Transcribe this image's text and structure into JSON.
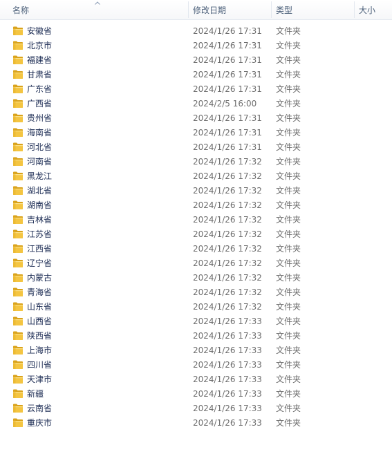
{
  "columns": {
    "name": "名称",
    "date_modified": "修改日期",
    "type": "类型",
    "size": "大小"
  },
  "colors": {
    "folder_yellow": "#f4c542",
    "folder_dark": "#d9a21b",
    "header_text": "#4c607a",
    "secondary_text": "#6d6d6d"
  },
  "items": [
    {
      "name": "安徽省",
      "date": "2024/1/26 17:31",
      "type": "文件夹",
      "icon": "folder-icon"
    },
    {
      "name": "北京市",
      "date": "2024/1/26 17:31",
      "type": "文件夹",
      "icon": "folder-icon"
    },
    {
      "name": "福建省",
      "date": "2024/1/26 17:31",
      "type": "文件夹",
      "icon": "folder-icon"
    },
    {
      "name": "甘肃省",
      "date": "2024/1/26 17:31",
      "type": "文件夹",
      "icon": "folder-icon"
    },
    {
      "name": "广东省",
      "date": "2024/1/26 17:31",
      "type": "文件夹",
      "icon": "folder-icon"
    },
    {
      "name": "广西省",
      "date": "2024/2/5 16:00",
      "type": "文件夹",
      "icon": "folder-icon"
    },
    {
      "name": "贵州省",
      "date": "2024/1/26 17:31",
      "type": "文件夹",
      "icon": "folder-icon"
    },
    {
      "name": "海南省",
      "date": "2024/1/26 17:31",
      "type": "文件夹",
      "icon": "folder-icon"
    },
    {
      "name": "河北省",
      "date": "2024/1/26 17:31",
      "type": "文件夹",
      "icon": "folder-icon"
    },
    {
      "name": "河南省",
      "date": "2024/1/26 17:32",
      "type": "文件夹",
      "icon": "folder-icon"
    },
    {
      "name": "黑龙江",
      "date": "2024/1/26 17:32",
      "type": "文件夹",
      "icon": "folder-icon"
    },
    {
      "name": "湖北省",
      "date": "2024/1/26 17:32",
      "type": "文件夹",
      "icon": "folder-icon"
    },
    {
      "name": "湖南省",
      "date": "2024/1/26 17:32",
      "type": "文件夹",
      "icon": "folder-icon"
    },
    {
      "name": "吉林省",
      "date": "2024/1/26 17:32",
      "type": "文件夹",
      "icon": "folder-icon"
    },
    {
      "name": "江苏省",
      "date": "2024/1/26 17:32",
      "type": "文件夹",
      "icon": "folder-icon"
    },
    {
      "name": "江西省",
      "date": "2024/1/26 17:32",
      "type": "文件夹",
      "icon": "folder-icon"
    },
    {
      "name": "辽宁省",
      "date": "2024/1/26 17:32",
      "type": "文件夹",
      "icon": "folder-icon"
    },
    {
      "name": "内蒙古",
      "date": "2024/1/26 17:32",
      "type": "文件夹",
      "icon": "folder-icon"
    },
    {
      "name": "青海省",
      "date": "2024/1/26 17:32",
      "type": "文件夹",
      "icon": "folder-icon"
    },
    {
      "name": "山东省",
      "date": "2024/1/26 17:32",
      "type": "文件夹",
      "icon": "folder-icon"
    },
    {
      "name": "山西省",
      "date": "2024/1/26 17:33",
      "type": "文件夹",
      "icon": "folder-icon"
    },
    {
      "name": "陕西省",
      "date": "2024/1/26 17:33",
      "type": "文件夹",
      "icon": "folder-icon"
    },
    {
      "name": "上海市",
      "date": "2024/1/26 17:33",
      "type": "文件夹",
      "icon": "folder-icon"
    },
    {
      "name": "四川省",
      "date": "2024/1/26 17:33",
      "type": "文件夹",
      "icon": "folder-icon"
    },
    {
      "name": "天津市",
      "date": "2024/1/26 17:33",
      "type": "文件夹",
      "icon": "folder-icon"
    },
    {
      "name": "新疆",
      "date": "2024/1/26 17:33",
      "type": "文件夹",
      "icon": "folder-icon"
    },
    {
      "name": "云南省",
      "date": "2024/1/26 17:33",
      "type": "文件夹",
      "icon": "folder-icon"
    },
    {
      "name": "重庆市",
      "date": "2024/1/26 17:33",
      "type": "文件夹",
      "icon": "folder-icon"
    }
  ]
}
